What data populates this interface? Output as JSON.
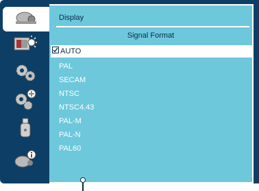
{
  "sidebar": {
    "items": [
      {
        "name": "display-icon",
        "active": true
      },
      {
        "name": "image-icon",
        "active": false
      },
      {
        "name": "setting-icon",
        "active": false
      },
      {
        "name": "expanded-setting-icon",
        "active": false
      },
      {
        "name": "usb-icon",
        "active": false
      },
      {
        "name": "info-icon",
        "active": false
      }
    ]
  },
  "panel": {
    "menu_title": "Display",
    "section_title": "Signal Format",
    "options": [
      {
        "label": "AUTO",
        "selected": true
      },
      {
        "label": "PAL",
        "selected": false
      },
      {
        "label": "SECAM",
        "selected": false
      },
      {
        "label": "NTSC",
        "selected": false
      },
      {
        "label": "NTSC4.43",
        "selected": false
      },
      {
        "label": "PAL-M",
        "selected": false
      },
      {
        "label": "PAL-N",
        "selected": false
      },
      {
        "label": "PAL60",
        "selected": false
      }
    ]
  },
  "colors": {
    "frame": "#0d3f66",
    "panel": "#6dc8dc",
    "text_dark": "#0b2a44",
    "text_light": "#ffffff"
  }
}
